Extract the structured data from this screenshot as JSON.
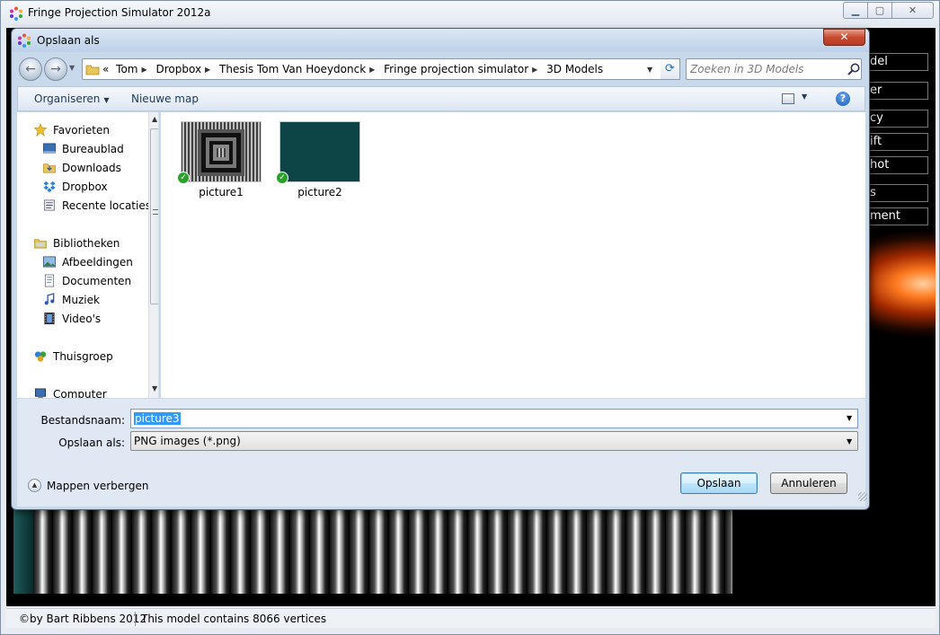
{
  "app": {
    "title": "Fringe Projection Simulator 2012a",
    "side_buttons": [
      "del",
      "er",
      "cy",
      "ift",
      "hot",
      "s",
      "ment"
    ],
    "status": {
      "copyright": "©by Bart Ribbens 2012",
      "vertices": "This model contains 8066 vertices"
    }
  },
  "dialog": {
    "title": "Opslaan als",
    "close_symbol": "✕",
    "breadcrumbs": [
      "Tom",
      "Dropbox",
      "Thesis Tom Van Hoeydonck",
      "Fringe projection simulator",
      "3D Models"
    ],
    "breadcrumb_lead": "«",
    "search_placeholder": "Zoeken in 3D Models",
    "toolbar": {
      "organize": "Organiseren",
      "new_folder": "Nieuwe map",
      "help": "?"
    },
    "nav": {
      "favorites": "Favorieten",
      "desktop": "Bureaublad",
      "downloads": "Downloads",
      "dropbox": "Dropbox",
      "recent": "Recente locaties",
      "libraries": "Bibliotheken",
      "pictures": "Afbeeldingen",
      "documents": "Documenten",
      "music": "Muziek",
      "videos": "Video's",
      "homegroup": "Thuisgroep",
      "computer": "Computer"
    },
    "files": [
      {
        "name": "picture1"
      },
      {
        "name": "picture2"
      }
    ],
    "fields": {
      "filename_label": "Bestandsnaam:",
      "filename_value": "picture3",
      "savetype_label": "Opslaan als:",
      "savetype_value": "PNG images (*.png)"
    },
    "hide_folders": "Mappen verbergen",
    "save_button": "Opslaan",
    "cancel_button": "Annuleren"
  },
  "colors": {
    "accent": "#3399ff",
    "thumb2": "#0d4547",
    "check": "#2aa12a"
  }
}
